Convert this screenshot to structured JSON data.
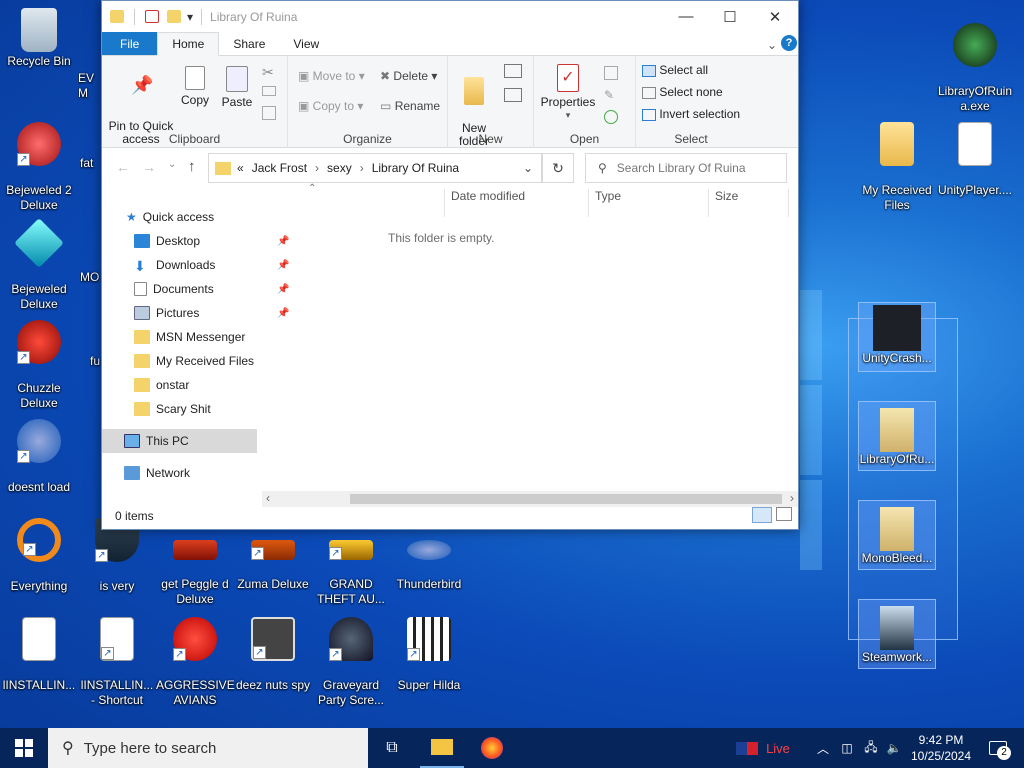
{
  "desktop": {
    "icons": [
      {
        "label": "Recycle Bin",
        "x": 0
      },
      {
        "label": "Bejeweled 2\nDeluxe"
      },
      {
        "label": "Bejeweled\nDeluxe"
      },
      {
        "label": "Chuzzle\nDeluxe"
      },
      {
        "label": "doesnt load"
      },
      {
        "label": "Everything"
      },
      {
        "label": "lINSTALLIN..."
      },
      {
        "label": "lINSTALLIN...\n- Shortcut"
      },
      {
        "label": "AGGRESSIVE\nAVIANS"
      },
      {
        "label": "deez nuts spy"
      },
      {
        "label": "Graveyard\nParty Scre..."
      },
      {
        "label": "Super Hilda"
      },
      {
        "label": "is very"
      },
      {
        "label": "get Peggle d\nDeluxe"
      },
      {
        "label": "Zuma Deluxe"
      },
      {
        "label": "GRAND\nTHEFT AU..."
      },
      {
        "label": "Thunderbird"
      },
      {
        "label": "LibraryOfRuin\na.exe"
      },
      {
        "label": "My Received\nFiles"
      },
      {
        "label": "UnityPlayer...."
      },
      {
        "label": "UnityCrash..."
      },
      {
        "label": "LibraryOfRu..."
      },
      {
        "label": "MonoBleed..."
      },
      {
        "label": "Steamwork..."
      },
      {
        "label": "EV\nM"
      },
      {
        "label": "fat"
      },
      {
        "label": "MO"
      },
      {
        "label": "fu"
      }
    ]
  },
  "explorer": {
    "title": "Library Of Ruina",
    "tabs": [
      "File",
      "Home",
      "Share",
      "View"
    ],
    "ribbon": {
      "clipboard": {
        "label": "Clipboard",
        "pin": "Pin to Quick\naccess",
        "copy": "Copy",
        "paste": "Paste"
      },
      "organize": {
        "label": "Organize",
        "move_to": "Move to",
        "copy_to": "Copy to",
        "delete": "Delete",
        "rename": "Rename"
      },
      "new": {
        "label": "New",
        "new_folder": "New\nfolder"
      },
      "open": {
        "label": "Open",
        "properties": "Properties"
      },
      "select": {
        "label": "Select",
        "select_all": "Select all",
        "select_none": "Select none",
        "invert": "Invert selection"
      }
    },
    "breadcrumb": [
      "«",
      "Jack Frost",
      "sexy",
      "Library Of Ruina"
    ],
    "search_placeholder": "Search Library Of Ruina",
    "nav": {
      "quick_access": "Quick access",
      "items": [
        "Desktop",
        "Downloads",
        "Documents",
        "Pictures",
        "MSN Messenger",
        "My Received Files",
        "onstar",
        "Scary Shit"
      ],
      "this_pc": "This PC",
      "network": "Network"
    },
    "columns": [
      "Date modified",
      "Type",
      "Size"
    ],
    "empty_text": "This folder is empty.",
    "status": "0 items"
  },
  "taskbar": {
    "search_placeholder": "Type here to search",
    "live_label": "Live",
    "time": "9:42 PM",
    "date": "10/25/2024",
    "notification_count": "2"
  }
}
